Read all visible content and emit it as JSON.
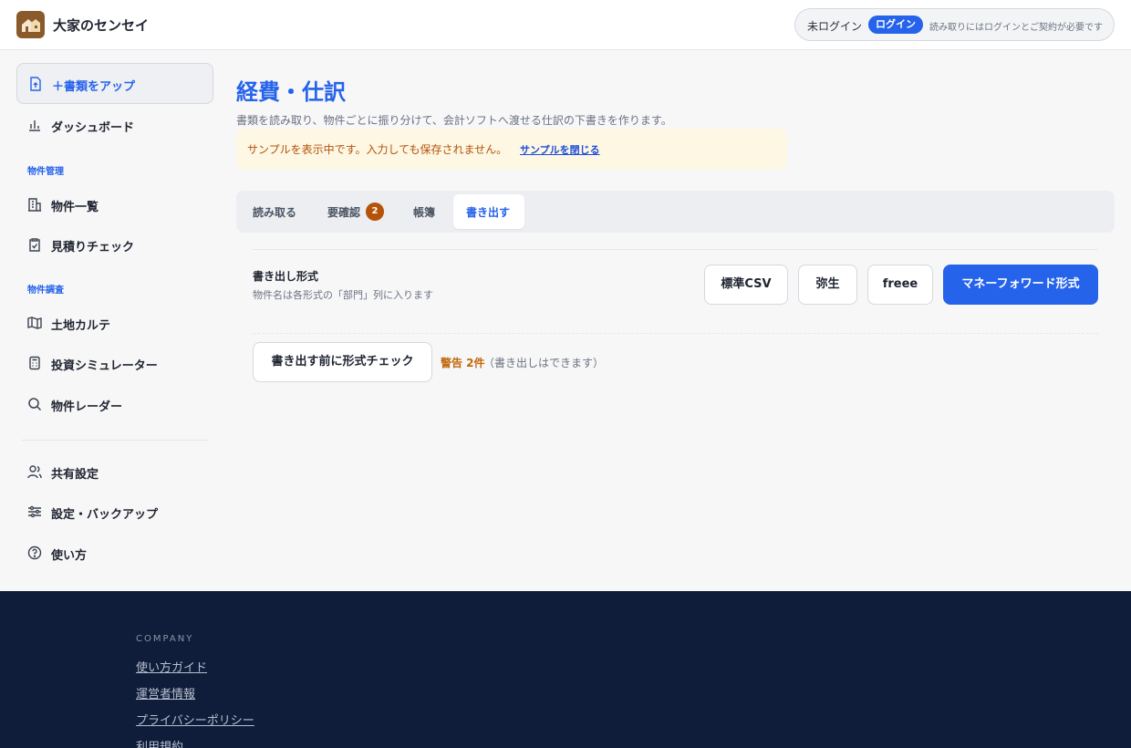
{
  "header": {
    "brand": "大家のセンセイ",
    "login_status": "未ログイン",
    "login_button": "ログイン",
    "login_note": "読み取りにはログインとご契約が必要です"
  },
  "sidebar": {
    "upload_label": "＋書類をアップ",
    "dashboard": "ダッシュボード",
    "section_property_mgmt": "物件管理",
    "property_list": "物件一覧",
    "estimate_check": "見積りチェック",
    "section_property_research": "物件調査",
    "land_karte": "土地カルテ",
    "investment_sim": "投資シミュレーター",
    "property_radar": "物件レーダー",
    "shared_settings": "共有設定",
    "settings_backup": "設定・バックアップ",
    "how_to_use": "使い方"
  },
  "main": {
    "title": "経費・仕訳",
    "description": "書類を読み取り、物件ごとに振り分けて、会計ソフトへ渡せる仕訳の下書きを作ります。",
    "sample_banner": "サンプルを表示中です。入力しても保存されません。",
    "sample_close": "サンプルを閉じる",
    "tabs": [
      {
        "label": "読み取る"
      },
      {
        "label": "要確認",
        "badge": "2"
      },
      {
        "label": "帳簿"
      },
      {
        "label": "書き出す"
      }
    ],
    "active_tab": "書き出す",
    "export": {
      "format_title": "書き出し形式",
      "format_sub": "物件名は各形式の「部門」列に入ります",
      "formats": [
        "標準CSV",
        "弥生",
        "freee",
        "マネーフォワード形式"
      ],
      "selected_format": "マネーフォワード形式",
      "check_button": "書き出す前に形式チェック",
      "warning_label": "警告 2件",
      "warning_note": "（書き出しはできます）"
    }
  },
  "footer": {
    "heading": "COMPANY",
    "links": [
      "使い方ガイド",
      "運営者情報",
      "プライバシーポリシー",
      "利用規約"
    ]
  },
  "colors": {
    "accent": "#2563eb",
    "warning": "#c2680c",
    "badge": "#b45309",
    "footer_bg": "#0f1c3a",
    "banner_bg": "#fdf7e3"
  }
}
